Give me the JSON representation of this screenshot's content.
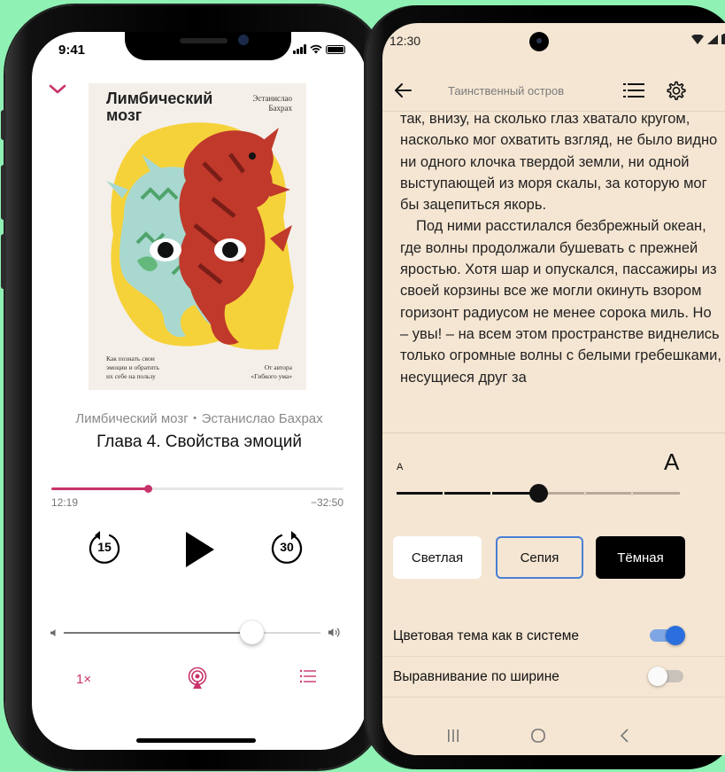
{
  "iphone": {
    "status_time": "9:41",
    "cover": {
      "title": "Лимбический\nмозг",
      "author": "Эстанислао\nБахрах",
      "subtitle": "Как познать свои\nэмоции и обратить\nих себе на пользу",
      "from_author": "От автора\n«Гибкого ума»"
    },
    "book_line": "Лимбический мозг・Эстанислао Бахрах",
    "chapter": "Глава 4. Свойства эмоций",
    "progress": 0.33,
    "time_elapsed": "12:19",
    "time_remaining": "−32:50",
    "skip_back": "15",
    "skip_forward": "30",
    "volume": 0.73,
    "speed": "1×",
    "accent_color": "#c8336b"
  },
  "android": {
    "status_time": "12:30",
    "title": "Таинственный остров",
    "text_cut": "так, внизу, на сколько глаз хватало кругом,",
    "text_p1": "насколько мог охватить взгляд, не было видно ни одного клочка твердой земли, ни одной выступающей из моря скалы, за которую мог бы зацепиться якорь.",
    "text_p2": "Под ними расстилался безбрежный океан, где волны продолжали бушевать с прежней яростью. Хотя шар и опускался, пассажиры из своей корзины все же могли окинуть взором горизонт радиусом не менее сорока миль. Но – увы! – на всем этом пространстве виднелись только огромные волны с белыми гребешками, несущиеся друг за",
    "size_small": "A",
    "size_big": "A",
    "font_size_level": 0.5,
    "themes": {
      "light": "Светлая",
      "sepia": "Сепия",
      "dark": "Тёмная"
    },
    "selected_theme": "sepia",
    "settings": [
      {
        "label": "Цветовая тема как в системе",
        "on": true
      },
      {
        "label": "Выравнивание по ширине",
        "on": false
      }
    ],
    "background_color": "#f5e6d3",
    "toggle_color": "#2b6fde"
  }
}
